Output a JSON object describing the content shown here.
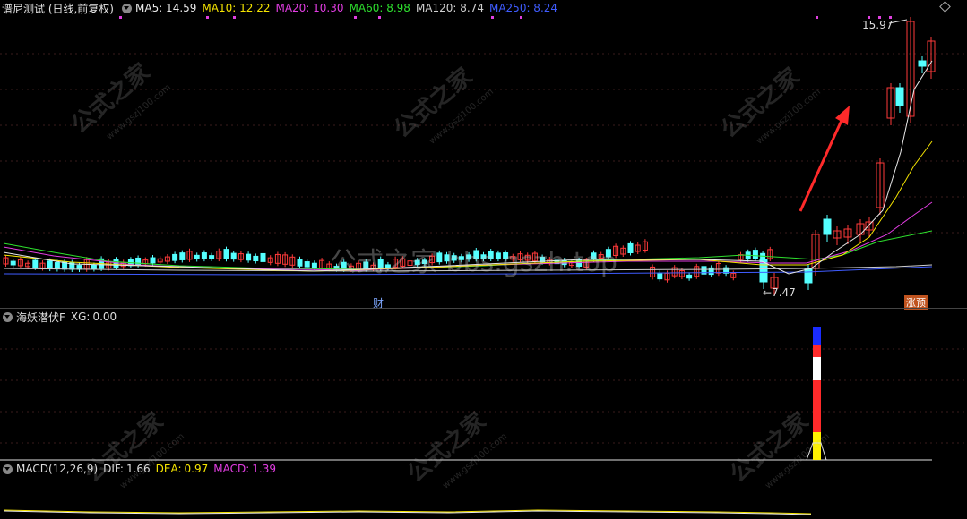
{
  "main": {
    "title": "谱尼测试 (日线,前复权)",
    "ma": [
      {
        "label": "MA5:",
        "value": "14.59",
        "color": "#e8e8e8"
      },
      {
        "label": "MA10:",
        "value": "12.22",
        "color": "#f5e400"
      },
      {
        "label": "MA20:",
        "value": "10.30",
        "color": "#e23de2"
      },
      {
        "label": "MA60:",
        "value": "8.98",
        "color": "#2ee02e"
      },
      {
        "label": "MA120:",
        "value": "8.74",
        "color": "#cfcfcf"
      },
      {
        "label": "MA250:",
        "value": "8.24",
        "color": "#3f5cff"
      }
    ],
    "high_label": "15.97",
    "low_label": "←7.47",
    "marker_cai": "财",
    "marker_zhang": "涨预",
    "watermark_center": "公式之家 bbs.gszh.top",
    "watermark": "公式之家",
    "watermark_url": "www.gszj100.com"
  },
  "indicator": {
    "title": "海妖潜伏F",
    "xg_label": "XG:",
    "xg_value": "0.00"
  },
  "macd": {
    "title": "MACD(12,26,9)",
    "dif_label": "DIF:",
    "dif_value": "1.66",
    "dea_label": "DEA:",
    "dea_value": "0.97",
    "macd_label": "MACD:",
    "macd_value": "1.39"
  },
  "colors": {
    "up": "#ff3a3a",
    "down": "#54ffff",
    "bg": "#000000"
  }
}
